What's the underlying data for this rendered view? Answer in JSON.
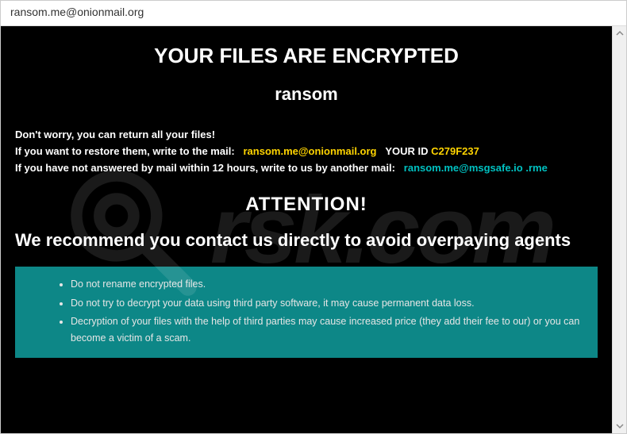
{
  "titlebar": {
    "text": "ransom.me@onionmail.org"
  },
  "header": {
    "title": "YOUR FILES ARE ENCRYPTED",
    "subtitle": "ransom"
  },
  "info": {
    "line1": "Don't worry, you can return all your files!",
    "line2_prefix": "If you want to restore them, write to the mail:",
    "email1": "ransom.me@onionmail.org",
    "your_id_label": "YOUR ID",
    "your_id_value": "C279F237",
    "line3_prefix": "If you have not answered by mail within 12 hours, write to us by another mail:",
    "email2": "ransom.me@msgsafe.io .rme"
  },
  "attention": "ATTENTION!",
  "recommend": "We recommend you contact us directly to avoid overpaying agents",
  "advice": {
    "items": [
      "Do not rename encrypted files.",
      "Do not try to decrypt your data using third party software, it may cause permanent data loss.",
      "Decryption of your files with the help of third parties may cause increased price (they add their fee to our) or you can become a victim of a scam."
    ]
  },
  "watermark": {
    "text": "rsk.com"
  }
}
